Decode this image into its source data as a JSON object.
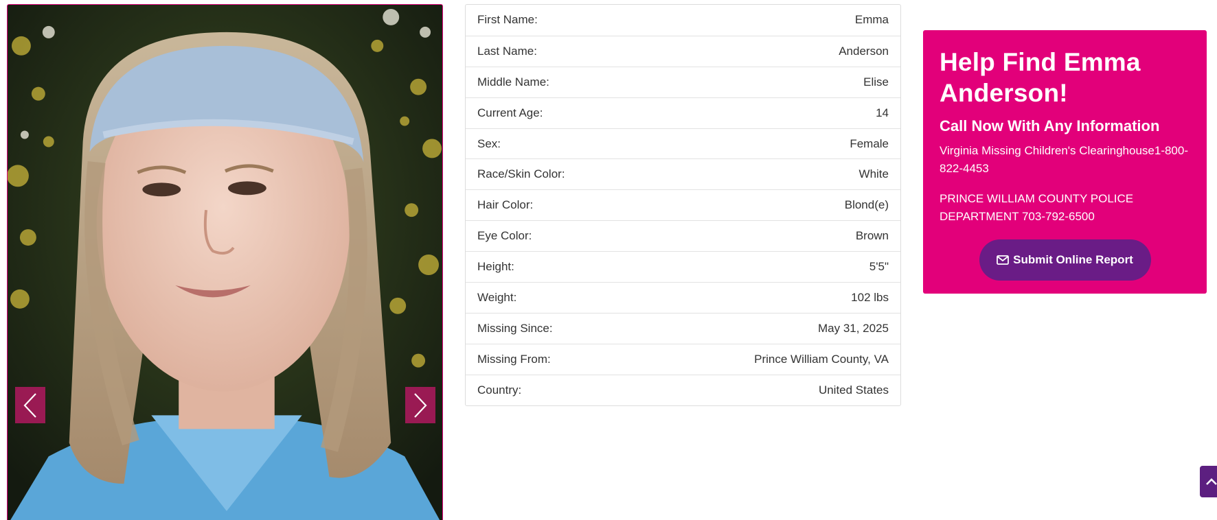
{
  "person": {
    "details": [
      {
        "label": "First Name:",
        "value": "Emma"
      },
      {
        "label": "Last Name:",
        "value": "Anderson"
      },
      {
        "label": "Middle Name:",
        "value": "Elise"
      },
      {
        "label": "Current Age:",
        "value": "14"
      },
      {
        "label": "Sex:",
        "value": "Female"
      },
      {
        "label": "Race/Skin Color:",
        "value": "White"
      },
      {
        "label": "Hair Color:",
        "value": "Blond(e)"
      },
      {
        "label": "Eye Color:",
        "value": "Brown"
      },
      {
        "label": "Height:",
        "value": "5'5\""
      },
      {
        "label": "Weight:",
        "value": "102 lbs"
      },
      {
        "label": "Missing Since:",
        "value": "May 31, 2025"
      },
      {
        "label": "Missing From:",
        "value": "Prince William County, VA"
      },
      {
        "label": "Country:",
        "value": "United States"
      }
    ]
  },
  "carousel": {
    "prev_icon": "chevron-left-icon",
    "next_icon": "chevron-right-icon"
  },
  "help": {
    "title": "Help Find Emma Anderson!",
    "subtitle": "Call Now With Any Information",
    "contact_1": "Virginia Missing Children's Clearinghouse1-800-822-4453",
    "contact_2": "PRINCE WILLIAM COUNTY POLICE DEPARTMENT 703-792-6500",
    "report_button": "Submit Online Report",
    "report_icon": "envelope-icon"
  },
  "back_to_top_icon": "chevron-up-icon",
  "colors": {
    "accent": "#e2007a",
    "button_purple": "#6a1c86",
    "carousel_button": "#b0195f"
  }
}
